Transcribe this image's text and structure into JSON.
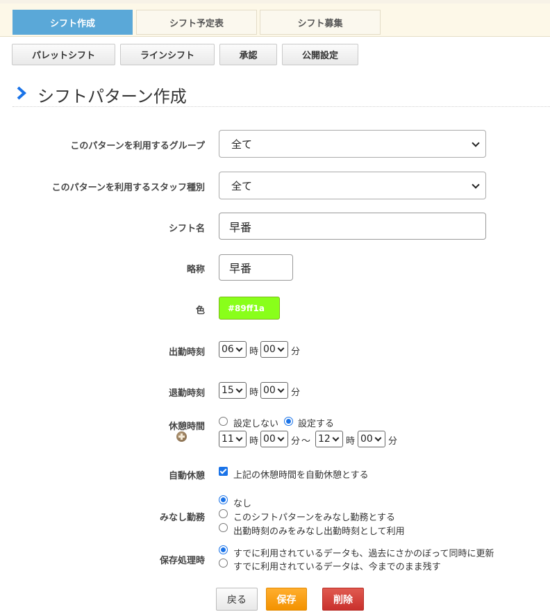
{
  "tabs": [
    {
      "label": "シフト作成",
      "active": true
    },
    {
      "label": "シフト予定表",
      "active": false
    },
    {
      "label": "シフト募集",
      "active": false
    }
  ],
  "subtabs": [
    "パレットシフト",
    "ラインシフト",
    "承認",
    "公開設定"
  ],
  "page_title": "シフトパターン作成",
  "form": {
    "group": {
      "label": "このパターンを利用するグループ",
      "value": "全て"
    },
    "staff_type": {
      "label": "このパターンを利用するスタッフ種別",
      "value": "全て"
    },
    "shift_name": {
      "label": "シフト名",
      "value": "早番"
    },
    "short_name": {
      "label": "略称",
      "value": "早番"
    },
    "color": {
      "label": "色",
      "value": "#89ff1a"
    },
    "start_time": {
      "label": "出勤時刻",
      "hour": "06",
      "hour_unit": "時",
      "minute": "00",
      "minute_unit": "分"
    },
    "end_time": {
      "label": "退勤時刻",
      "hour": "15",
      "hour_unit": "時",
      "minute": "00",
      "minute_unit": "分"
    },
    "break_time": {
      "label": "休憩時間",
      "option_off": "設定しない",
      "option_on": "設定する",
      "selected": "on",
      "from_hour": "11",
      "from_minute": "00",
      "to_hour": "12",
      "to_minute": "00",
      "hour_unit": "時",
      "minute_unit": "分",
      "separator": "〜"
    },
    "auto_break": {
      "label": "自動休憩",
      "checked": true,
      "text": "上記の休憩時間を自動休憩とする"
    },
    "deemed_work": {
      "label": "みなし勤務",
      "options": [
        "なし",
        "このシフトパターンをみなし勤務とする",
        "出勤時刻のみをみなし出勤時刻として利用"
      ],
      "selected_index": 0
    },
    "save_process": {
      "label": "保存処理時",
      "options": [
        "すでに利用されているデータも、過去にさかのぼって同時に更新",
        "すでに利用されているデータは、今までのまま残す"
      ],
      "selected_index": 0
    }
  },
  "buttons": {
    "back": "戻る",
    "save": "保存",
    "delete": "削除"
  },
  "colors": {
    "tab_active": "#5aa8d8",
    "accent_blue": "#1a73e8",
    "save": "#f39200",
    "delete": "#c9302c"
  }
}
